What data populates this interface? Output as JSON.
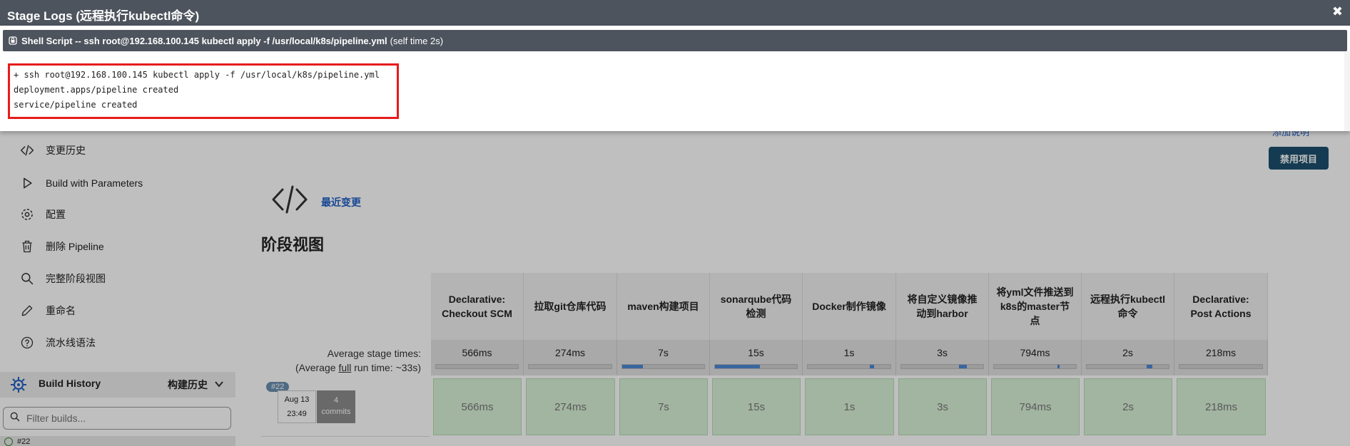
{
  "modal": {
    "title": "Stage Logs (远程执行kubectl命令)",
    "close": "✖",
    "step": {
      "name": "Shell Script -- ssh root@192.168.100.145 kubectl apply -f /usr/local/k8s/pipeline.yml",
      "self_time": "(self time 2s)"
    },
    "log_lines": [
      "+ ssh root@192.168.100.145 kubectl apply -f /usr/local/k8s/pipeline.yml",
      "deployment.apps/pipeline created",
      "service/pipeline created"
    ]
  },
  "sidebar": {
    "items": [
      {
        "label": "变更历史",
        "icon": "code-icon"
      },
      {
        "label": "Build with Parameters",
        "icon": "play-icon"
      },
      {
        "label": "配置",
        "icon": "gear-icon"
      },
      {
        "label": "删除 Pipeline",
        "icon": "trash-icon"
      },
      {
        "label": "完整阶段视图",
        "icon": "search-icon"
      },
      {
        "label": "重命名",
        "icon": "pencil-icon"
      },
      {
        "label": "流水线语法",
        "icon": "help-icon"
      }
    ],
    "build_history": {
      "title": "Build History",
      "title_cn": "构建历史",
      "filter_placeholder": "Filter builds...",
      "first_build": "#22"
    }
  },
  "main": {
    "add_description": "添加说明",
    "disable_button": "禁用项目",
    "recent_changes": "最近变更",
    "stage_view_title": "阶段视图",
    "avg_label_1": "Average stage times:",
    "avg_label_2a": "(Average ",
    "avg_label_2b": "full",
    "avg_label_2c": " run time: ~33s)",
    "run": {
      "badge": "#22",
      "date": "Aug 13",
      "time": "23:49",
      "commits_count": "4",
      "commits_label": "commits"
    },
    "stages": [
      {
        "name": "Declarative: Checkout SCM",
        "avg": "566ms",
        "time": "566ms",
        "progress": 0.0
      },
      {
        "name": "拉取git仓库代码",
        "avg": "274ms",
        "time": "274ms",
        "progress": 0.0
      },
      {
        "name": "maven构建项目",
        "avg": "7s",
        "time": "7s",
        "progress": 0.25
      },
      {
        "name": "sonarqube代码检测",
        "avg": "15s",
        "time": "15s",
        "progress": 0.55
      },
      {
        "name": "Docker制作镜像",
        "avg": "1s",
        "time": "1s",
        "progress": 0.05
      },
      {
        "name": "将自定义镜像推动到harbor",
        "avg": "3s",
        "time": "3s",
        "progress": 0.1
      },
      {
        "name": "将yml文件推送到k8s的master节点",
        "avg": "794ms",
        "time": "794ms",
        "progress": 0.03
      },
      {
        "name": "远程执行kubectl命令",
        "avg": "2s",
        "time": "2s",
        "progress": 0.07
      },
      {
        "name": "Declarative: Post Actions",
        "avg": "218ms",
        "time": "218ms",
        "progress": 0.0
      }
    ]
  }
}
